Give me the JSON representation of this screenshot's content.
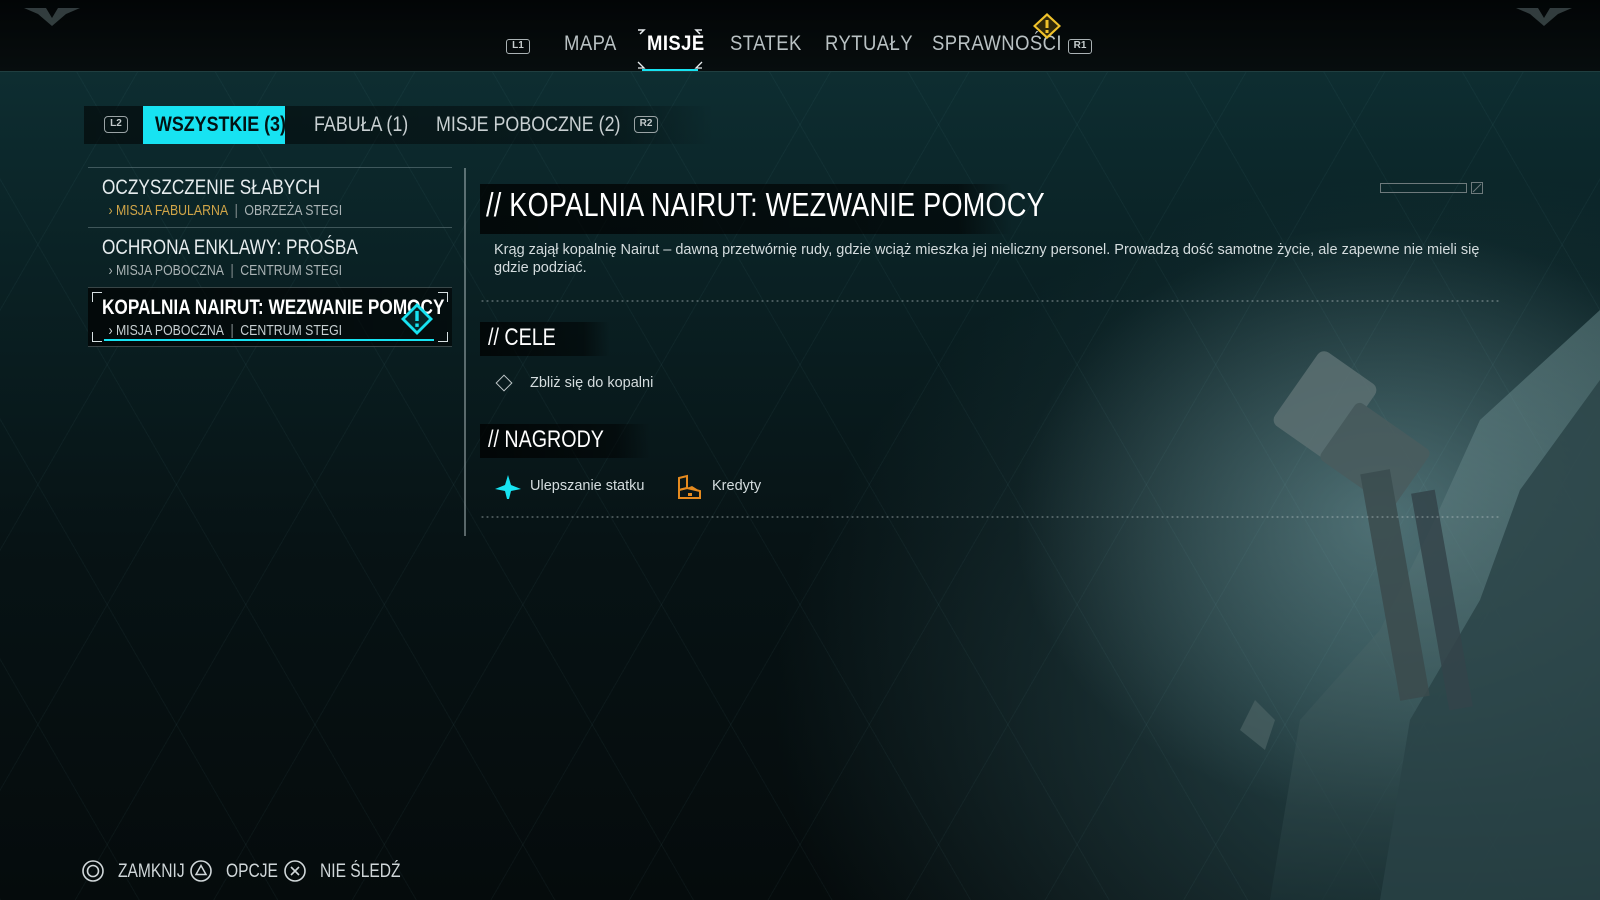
{
  "top_nav": {
    "left_hint": "L1",
    "right_hint": "R1",
    "tabs": [
      {
        "label": "MAPA",
        "active": false
      },
      {
        "label": "MISJE",
        "active": true
      },
      {
        "label": "STATEK",
        "active": false
      },
      {
        "label": "RYTUAŁY",
        "active": false
      },
      {
        "label": "SPRAWNOŚCI",
        "active": false,
        "badge": "warning-icon"
      }
    ]
  },
  "sub_tabs": {
    "left_hint": "L2",
    "right_hint": "R2",
    "tabs": [
      {
        "label": "WSZYSTKIE (3)",
        "active": true
      },
      {
        "label": "FABUŁA (1)",
        "active": false
      },
      {
        "label": "MISJE POBOCZNE (2)",
        "active": false
      }
    ]
  },
  "missions": [
    {
      "title": "OCZYSZCZENIE SŁABYCH",
      "type": "MISJA FABULARNA",
      "location": "OBRZEŻA STEGI",
      "selected": false
    },
    {
      "title": "OCHRONA ENKLAWY: PROŚBA",
      "type": "MISJA POBOCZNA",
      "location": "CENTRUM STEGI",
      "selected": false
    },
    {
      "title": "KOPALNIA NAIRUT: WEZWANIE POMOCY",
      "type": "MISJA POBOCZNA",
      "location": "CENTRUM STEGI",
      "selected": true,
      "icon": "exclamation-diamond-icon"
    }
  ],
  "detail": {
    "title": "// KOPALNIA NAIRUT: WEZWANIE POMOCY",
    "description": "Krąg zajął kopalnię Nairut – dawną przetwórnię rudy, gdzie wciąż mieszka jej nieliczny personel. Prowadzą dość samotne życie, ale zapewne nie mieli się gdzie podziać.",
    "objectives_header": "// CELE",
    "objectives": [
      {
        "text": "Zbliż się do kopalni",
        "icon": "diamond-outline-icon"
      }
    ],
    "rewards_header": "// NAGRODY",
    "rewards": [
      {
        "text": "Ulepszanie statku",
        "icon": "ship-icon"
      },
      {
        "text": "Kredyty",
        "icon": "credits-chest-icon"
      }
    ]
  },
  "footer": {
    "actions": [
      {
        "button": "circle-button-icon",
        "label": "ZAMKNIJ"
      },
      {
        "button": "triangle-button-icon",
        "label": "OPCJE"
      },
      {
        "button": "cross-button-icon",
        "label": "NIE ŚLEDŹ"
      }
    ]
  },
  "colors": {
    "accent": "#17e3f2",
    "warning": "#f0c22b",
    "main_mission": "#d0a548",
    "credits": "#e58a1f"
  }
}
